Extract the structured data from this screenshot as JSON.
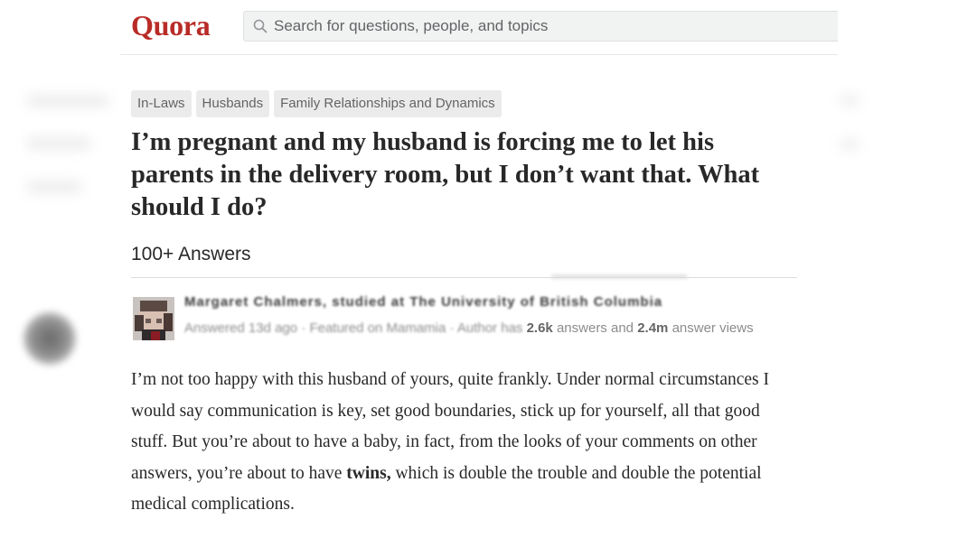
{
  "header": {
    "logo": "Quora",
    "search_placeholder": "Search for questions, people, and topics"
  },
  "topics": [
    "In-Laws",
    "Husbands",
    "Family Relationships and Dynamics"
  ],
  "question": {
    "title": "I’m pregnant and my husband is forcing me to let his parents in the delivery room, but I don’t want that. What should I do?"
  },
  "answers": {
    "count_label": "100+ Answers"
  },
  "answer": {
    "author_line": "Margaret Chalmers, studied at The University of British Columbia",
    "answered": "Answered 13d ago",
    "featured": "Featured on Mamamia",
    "author_has_prefix": "Author has",
    "answer_count": "2.6k",
    "answers_and": "answers and",
    "view_count": "2.4m",
    "views_suffix": "answer views",
    "body_before": "I’m not too happy with this husband of yours, quite frankly. Under normal circumstances I would say communication is key, set good boundaries, stick up for yourself, all that good stuff. But you’re about to have a baby, in fact, from the looks of your comments on other answers, you’re about to have ",
    "body_bold": "twins,",
    "body_after": " which is double the trouble and double the potential medical complications."
  },
  "colors": {
    "brand": "#b92b27",
    "text": "#282829",
    "muted": "#8c8c8c"
  }
}
